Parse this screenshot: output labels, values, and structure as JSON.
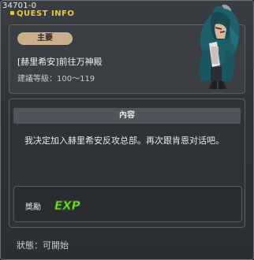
{
  "window": {
    "quest_id": "34701-0",
    "title": "QUEST INFO"
  },
  "header": {
    "tag": "主要",
    "quest_name": "[赫里希安]前往万神殿",
    "level_label": "建議等級：",
    "level_range": "100～119"
  },
  "content": {
    "section_title": "內容",
    "description": "我决定加入赫里希安反攻总部。再次跟肯恩对话吧。",
    "reward_label": "獎勵",
    "reward_type": "EXP"
  },
  "footer": {
    "status": "狀態：可開始"
  },
  "colors": {
    "title_accent": "#e6c83a",
    "tag_bg": "#c9b08a",
    "exp_green": "#7ee83a"
  },
  "icons": {
    "character": "hooded-character-illustration",
    "reward": "exp-icon"
  }
}
